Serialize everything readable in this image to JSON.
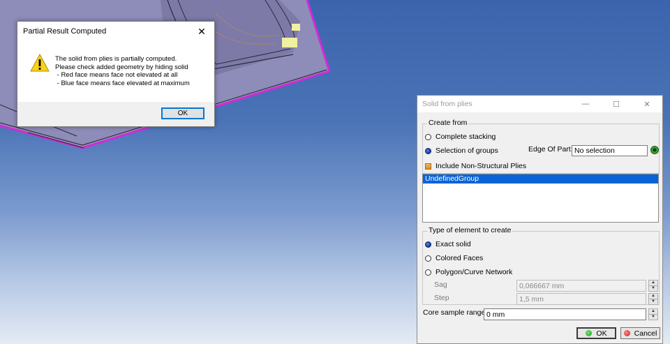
{
  "message_box": {
    "title": "Partial Result Computed",
    "close_glyph": "✕",
    "icon": "warning-icon",
    "message": "The solid from plies is partially computed.\nPlease check added geometry by hiding solid\n - Red face means face not elevated at all\n - Blue face means face elevated at maximum",
    "ok_label": "OK"
  },
  "dialog": {
    "title": "Solid from plies",
    "minimize_glyph": "—",
    "maximize_glyph": "☐",
    "close_glyph": "✕",
    "create_from": {
      "label": "Create from",
      "complete_stacking": "Complete stacking",
      "selection_of_groups": "Selection of groups",
      "selected": "selection_of_groups",
      "edge_of_part_label": "Edge Of Part:",
      "edge_of_part_value": "No selection",
      "include_non_structural": "Include Non-Structural Plies",
      "include_non_structural_checked": true
    },
    "groups_list": [
      "UndefinedGroup"
    ],
    "element_type": {
      "label": "Type of element to create",
      "exact_solid": "Exact solid",
      "colored_faces": "Colored Faces",
      "polygon_network": "Polygon/Curve Network",
      "selected": "exact_solid",
      "sag_label": "Sag",
      "sag_value": "0,066667 mm",
      "step_label": "Step",
      "step_value": "1,5 mm"
    },
    "core_sample_label": "Core sample range",
    "core_sample_value": "0 mm",
    "ok_label": "OK",
    "cancel_label": "Cancel"
  },
  "colors": {
    "selection_blue": "#0a64d7",
    "model_edge_magenta": "#d22ad8",
    "model_fill": "#8a88b4"
  }
}
